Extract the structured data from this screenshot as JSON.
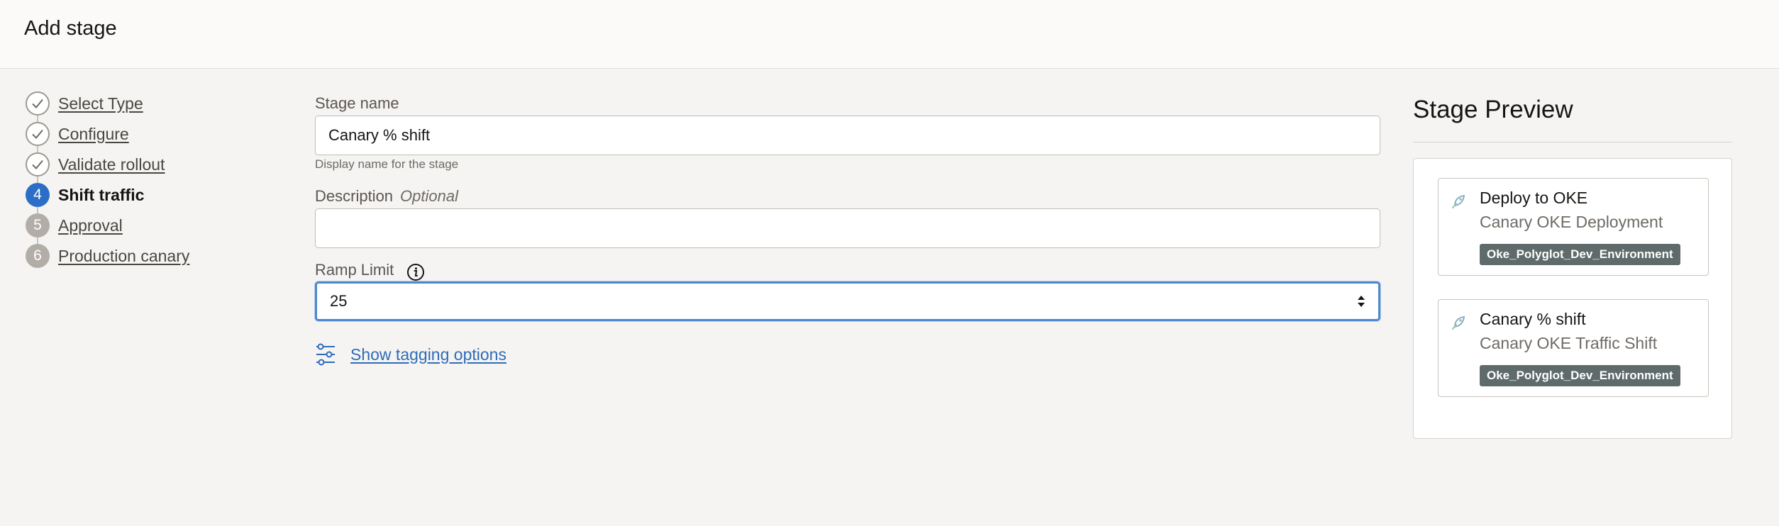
{
  "header": {
    "title": "Add stage"
  },
  "steps": [
    {
      "number": "1",
      "label": "Select Type",
      "status": "done"
    },
    {
      "number": "2",
      "label": "Configure",
      "status": "done"
    },
    {
      "number": "3",
      "label": "Validate rollout",
      "status": "done"
    },
    {
      "number": "4",
      "label": "Shift traffic",
      "status": "current"
    },
    {
      "number": "5",
      "label": "Approval",
      "status": "todo"
    },
    {
      "number": "6",
      "label": "Production canary",
      "status": "todo"
    }
  ],
  "form": {
    "stage_name": {
      "label": "Stage name",
      "value": "Canary % shift",
      "hint": "Display name for the stage"
    },
    "description": {
      "label": "Description",
      "optional": "Optional",
      "value": ""
    },
    "ramp_limit": {
      "label": "Ramp Limit",
      "value": "25"
    },
    "tagging_link": "Show tagging options"
  },
  "preview": {
    "title": "Stage Preview",
    "stages": [
      {
        "name": "Deploy to OKE",
        "type": "Canary OKE Deployment",
        "environment": "Oke_Polyglot_Dev_Environment"
      },
      {
        "name": "Canary % shift",
        "type": "Canary OKE Traffic Shift",
        "environment": "Oke_Polyglot_Dev_Environment"
      }
    ]
  },
  "colors": {
    "accent": "#2c6ec5",
    "link": "#2e6cb8",
    "tag_bg": "#5f6a6a",
    "focus_border": "#4c88cf"
  },
  "icons": [
    "check-icon",
    "info-icon",
    "spinner-arrows-icon",
    "tagging-options-icon",
    "stage-icon"
  ]
}
